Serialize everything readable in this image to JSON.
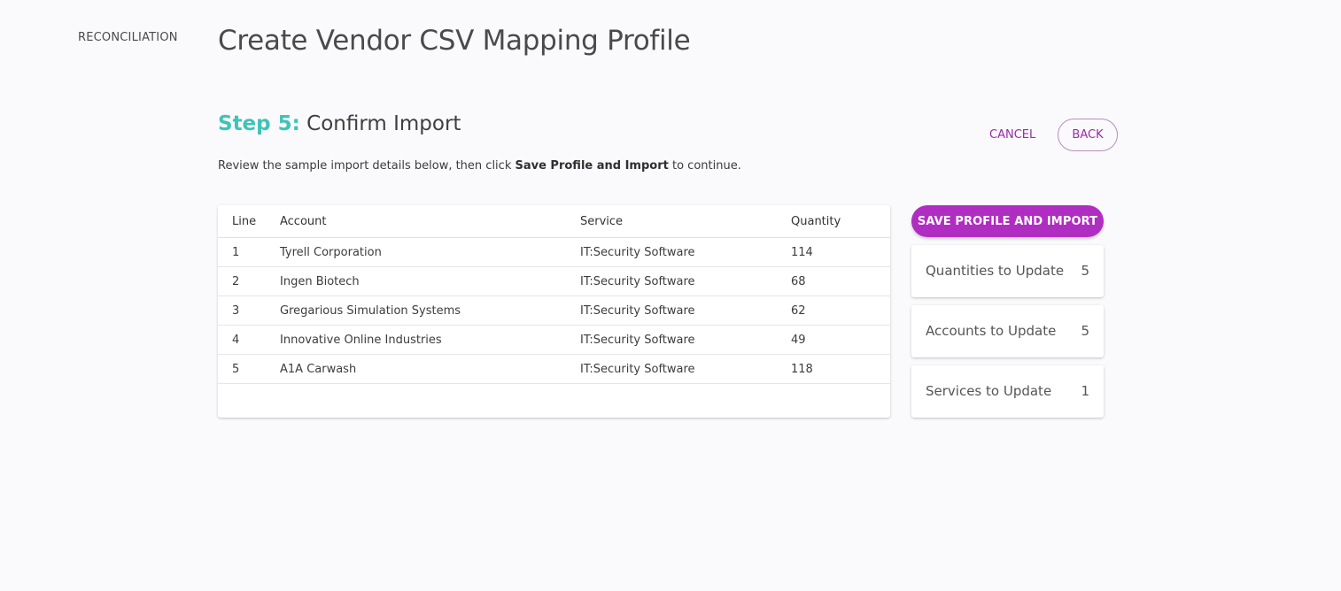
{
  "nav": {
    "section_label": "RECONCILIATION"
  },
  "header": {
    "title": "Create Vendor CSV Mapping Profile"
  },
  "step": {
    "prefix": "Step 5:",
    "title": "Confirm Import"
  },
  "actions": {
    "cancel_label": "CANCEL",
    "back_label": "BACK",
    "save_label": "SAVE PROFILE AND IMPORT"
  },
  "instructions": {
    "before": "Review the sample import details below, then click ",
    "emphasis": "Save Profile and Import",
    "after": " to continue."
  },
  "table": {
    "columns": [
      "Line",
      "Account",
      "Service",
      "Quantity"
    ],
    "rows": [
      [
        "1",
        "Tyrell Corporation",
        "IT:Security Software",
        "114"
      ],
      [
        "2",
        "Ingen Biotech",
        "IT:Security Software",
        "68"
      ],
      [
        "3",
        "Gregarious Simulation Systems",
        "IT:Security Software",
        "62"
      ],
      [
        "4",
        "Innovative Online Industries",
        "IT:Security Software",
        "49"
      ],
      [
        "5",
        "A1A Carwash",
        "IT:Security Software",
        "118"
      ]
    ]
  },
  "summary": [
    {
      "label": "Quantities to Update",
      "value": "5"
    },
    {
      "label": "Accounts to Update",
      "value": "5"
    },
    {
      "label": "Services to Update",
      "value": "1"
    }
  ],
  "colors": {
    "accent_teal": "#3ec4b8",
    "accent_purple": "#b02dc2",
    "link_purple": "#9b2aa8",
    "background": "#fafafc"
  }
}
